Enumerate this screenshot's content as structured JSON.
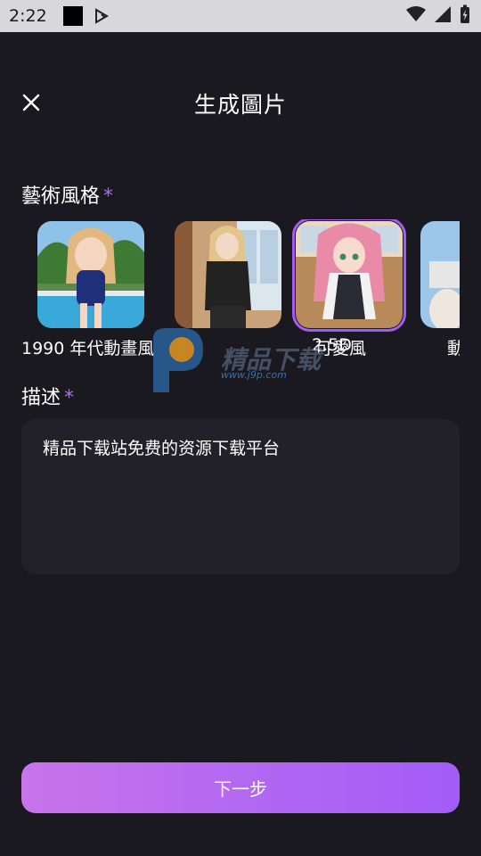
{
  "status_bar": {
    "time": "2:22"
  },
  "header": {
    "title": "生成圖片"
  },
  "art_style": {
    "label": "藝術風格",
    "required_mark": "*",
    "items": [
      {
        "name": "1990 年代動畫風",
        "selected": false
      },
      {
        "name": "2.5D",
        "selected": false
      },
      {
        "name": "可愛風",
        "selected": true
      },
      {
        "name": "動",
        "selected": false
      }
    ]
  },
  "description": {
    "label": "描述",
    "required_mark": "*",
    "value": "精品下载站免费的资源下载平台"
  },
  "footer": {
    "next_label": "下一步"
  },
  "watermark": {
    "brand": "精品下载",
    "url": "www.j9p.com"
  },
  "colors": {
    "background": "#1a1920",
    "accent": "#a35cf3",
    "input_bg": "#222129"
  }
}
